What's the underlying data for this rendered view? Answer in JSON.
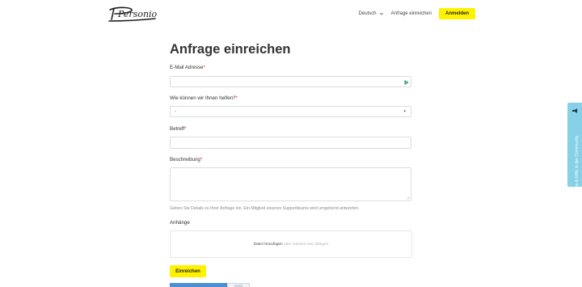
{
  "header": {
    "logo_text": "Personio",
    "nav": {
      "language": "Deutsch",
      "submit_request": "Anfrage einreichen",
      "login": "Anmelden"
    }
  },
  "form": {
    "title": "Anfrage einreichen",
    "required_mark": "*",
    "fields": {
      "email": {
        "label": "E-Mail Adresse",
        "value": ""
      },
      "topic": {
        "label": "Wie können wir Ihnen helfen?",
        "selected": "-"
      },
      "subject": {
        "label": "Betreff",
        "value": ""
      },
      "description": {
        "label": "Beschreibung",
        "value": "",
        "help": "Geben Sie Details zu Ihrer Anfrage ein. Ein Mitglied unseres Supportteams wird umgehend antworten."
      }
    },
    "attachments": {
      "label": "Anhänge",
      "add_file": "Datei hinzufügen",
      "drop_hint": "oder Dateien hier ablegen"
    },
    "submit_label": "Einreichen"
  },
  "side_tab": {
    "label": "Tipps & Hilfe in der Community"
  },
  "colors": {
    "accent_yellow": "#fff200",
    "required_red": "#d33333",
    "side_tab": "#86d1e8",
    "email_icon": "#2f9e6b"
  },
  "icons": {
    "logo": "personio-logo",
    "language": "chevron-down-icon",
    "email": "password-manager-icon",
    "select": "caret-down-icon",
    "side": "megaphone-icon"
  }
}
